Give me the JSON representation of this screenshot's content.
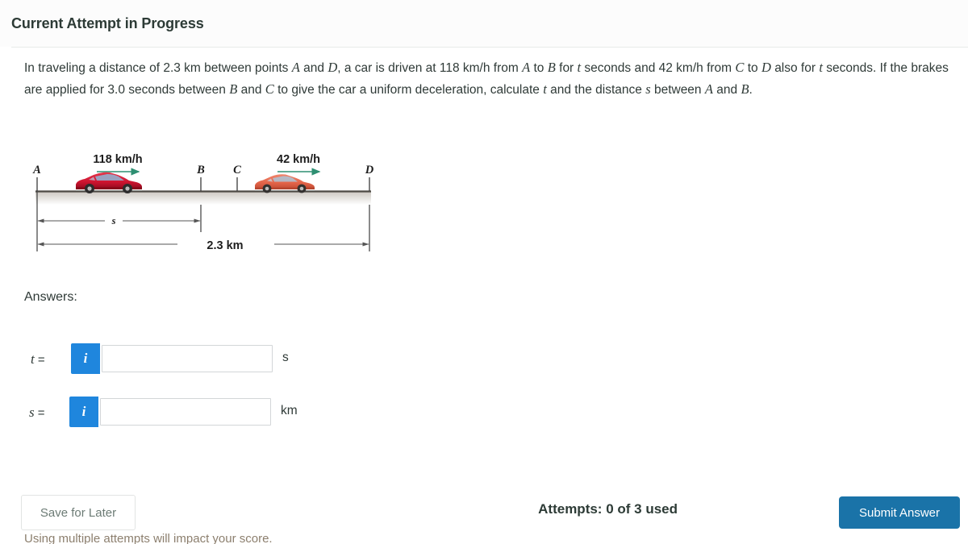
{
  "header": {
    "title": "Current Attempt in Progress"
  },
  "problem": {
    "line1_a": "In traveling a distance of 2.3 km between points ",
    "var_A1": "A",
    "line1_b": " and ",
    "var_D1": "D",
    "line1_c": ", a car is driven at 118 km/h from ",
    "var_A2": "A",
    "line1_d": " to ",
    "var_B1": "B",
    "line1_e": " for ",
    "var_t1": "t",
    "line1_f": " seconds and 42 km/h from ",
    "var_C1": "C",
    "line1_g": " to ",
    "var_D2": "D",
    "line2_a": "also for ",
    "var_t2": "t",
    "line2_b": " seconds. If the brakes are applied for 3.0 seconds between ",
    "var_B2": "B",
    "line2_c": " and ",
    "var_C2": "C",
    "line2_d": " to give the car a uniform deceleration, calculate ",
    "var_t3": "t",
    "line2_e": " and the",
    "line3_a": "distance ",
    "var_s1": "s",
    "line3_b": " between ",
    "var_A3": "A",
    "line3_c": " and ",
    "var_B3": "B",
    "line3_d": "."
  },
  "figure": {
    "speed_left": "118 km/h",
    "speed_right": "42 km/h",
    "point_a": "A",
    "point_b": "B",
    "point_c": "C",
    "point_d": "D",
    "dim_s": "s",
    "dim_total": "2.3 km",
    "colors": {
      "arrow": "#2e8f72",
      "road": "#4d4a45",
      "car_left": "#cf1430",
      "car_right": "#e4654a",
      "dimension_line": "#555555"
    }
  },
  "answers": {
    "label": "Answers:",
    "rows": [
      {
        "var": "t",
        "equals": " =",
        "info_icon": "info-icon",
        "info_glyph": "i",
        "value": "",
        "placeholder": "",
        "unit": "s"
      },
      {
        "var": "s",
        "equals": " =",
        "info_icon": "info-icon",
        "info_glyph": "i",
        "value": "",
        "placeholder": "",
        "unit": "km"
      }
    ]
  },
  "footer": {
    "save_label": "Save for Later",
    "footnote": "Using multiple attempts will impact your score.",
    "attempts": "Attempts: 0 of 3 used",
    "submit_label": "Submit Answer"
  },
  "theme": {
    "accent_blue": "#1f86dd",
    "submit_blue": "#1a73a8",
    "text": "#2f3a37"
  }
}
